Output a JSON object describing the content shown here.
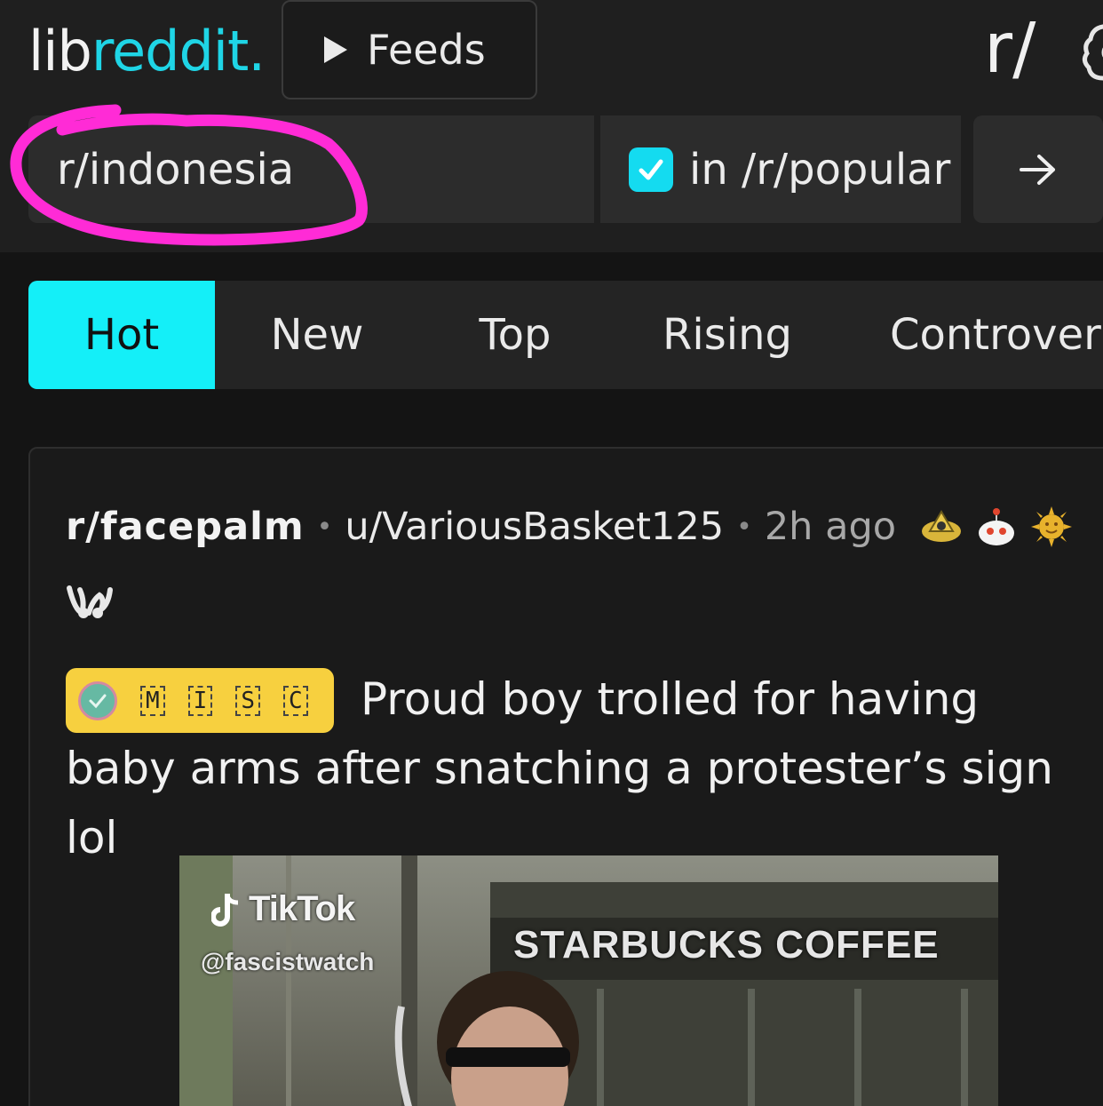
{
  "header": {
    "logo_lib": "lib",
    "logo_reddit": "reddit.",
    "feeds_label": "Feeds",
    "rslash_label": "r/"
  },
  "search": {
    "value": "r/indonesia",
    "restrict_label": "in /r/popular",
    "restrict_checked": true,
    "submit_icon": "arrow-right-icon"
  },
  "sort": {
    "tabs": [
      {
        "label": "Hot",
        "active": true
      },
      {
        "label": "New",
        "active": false
      },
      {
        "label": "Top",
        "active": false
      },
      {
        "label": "Rising",
        "active": false
      },
      {
        "label": "Controver",
        "active": false
      }
    ]
  },
  "post": {
    "subreddit": "r/facepalm",
    "author": "u/VariousBasket125",
    "time": "2h ago",
    "awards": [
      "hat-award-icon",
      "snoo-award-icon",
      "sun-award-icon",
      "bunny-award-icon"
    ],
    "flair": {
      "letters": [
        "M",
        "I",
        "S",
        "C"
      ]
    },
    "title": "Proud boy trolled for having baby arms after snatching a protester’s sign lol",
    "media": {
      "brand": "TikTok",
      "handle": "@fascistwatch",
      "sign": "STARBUCKS COFFEE"
    }
  },
  "colors": {
    "accent": "#14eff8",
    "logo_accent": "#1fd5e6",
    "flair_bg": "#f7d03f",
    "highlight": "#ff2bd6",
    "background": "#141414"
  }
}
